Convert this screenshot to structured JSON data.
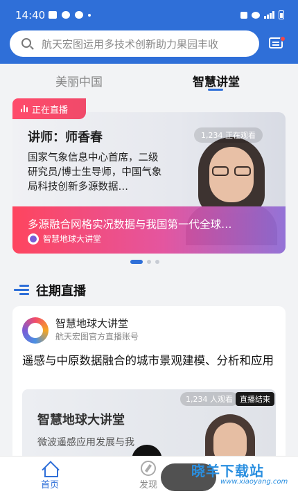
{
  "status_bar": {
    "time": "14:40",
    "extra": "•"
  },
  "search": {
    "placeholder": "航天宏图运用多技术创新助力果园丰收"
  },
  "tabs": [
    {
      "label": "美丽中国",
      "active": false
    },
    {
      "label": "智慧讲堂",
      "active": true
    }
  ],
  "banner": {
    "live_tag": "正在直播",
    "lecturer": "讲师：师香春",
    "bio": "国家气象信息中心首席，二级研究员/博士生导师，中国气象局科技创新多源数据…",
    "viewers": "1,234 正在观看",
    "title": "多源融合网格实况数据与我国第一代全球…",
    "channel": "智慧地球大讲堂"
  },
  "section": {
    "title": "往期直播"
  },
  "card": {
    "account_name": "智慧地球大讲堂",
    "account_sub": "航天宏图官方直播账号",
    "title": "遥感与中原数据融合的城市景观建模、分析和应用",
    "thumb_title": "智慧地球大讲堂",
    "thumb_sub": "微波遥感应用发展与我",
    "thumb_viewers": "1,234 人观看",
    "thumb_status": "直播结束"
  },
  "bottom_nav": [
    {
      "label": "首页",
      "active": true
    },
    {
      "label": "发现",
      "active": false
    }
  ],
  "watermark": {
    "text": "晓羊下载站",
    "url": "www.xiaoyang.com"
  },
  "colors": {
    "primary": "#2f6fd8",
    "live": "#ff4b6b"
  }
}
